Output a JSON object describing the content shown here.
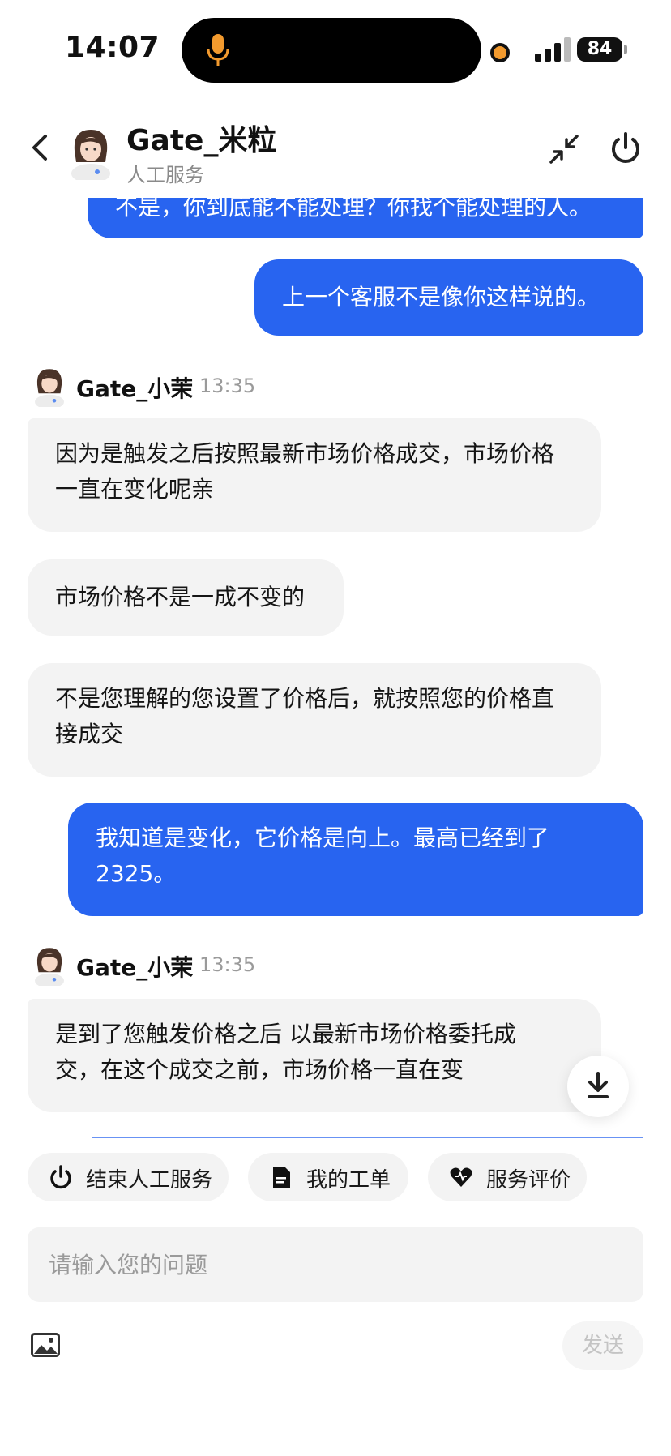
{
  "status_bar": {
    "time": "14:07",
    "battery": "84"
  },
  "header": {
    "agent_name": "Gate_米粒",
    "agent_subtitle": "人工服务"
  },
  "messages": {
    "m0": "不是，你到底能不能处理？你找个能处理的人。",
    "m1": "上一个客服不是像你这样说的。",
    "head1": {
      "name": "Gate_小茉",
      "time": "13:35"
    },
    "m2": "因为是触发之后按照最新市场价格成交，市场价格一直在变化呢亲",
    "m3": "市场价格不是一成不变的",
    "m4": "不是您理解的您设置了价格后，就按照您的价格直接成交",
    "m5": "我知道是变化，它价格是向上。最高已经到了2325。",
    "head2": {
      "name": "Gate_小茉",
      "time": "13:35"
    },
    "m6": "是到了您触发价格之后 以最新市场价格委托成交，在这个成交之前，市场价格一直在变"
  },
  "quick_actions": {
    "end_service": "结束人工服务",
    "my_tickets": "我的工单",
    "rate_service": "服务评价"
  },
  "composer": {
    "placeholder": "请输入您的问题",
    "send_label": "发送"
  },
  "colors": {
    "accent": "#2864f0",
    "bubble_in": "#f3f3f3",
    "recording": "#f29a2e"
  },
  "icons": [
    "microphone-icon",
    "back-arrow-icon",
    "minimize-icon",
    "power-icon",
    "download-icon",
    "document-icon",
    "heart-rating-icon",
    "image-icon"
  ]
}
